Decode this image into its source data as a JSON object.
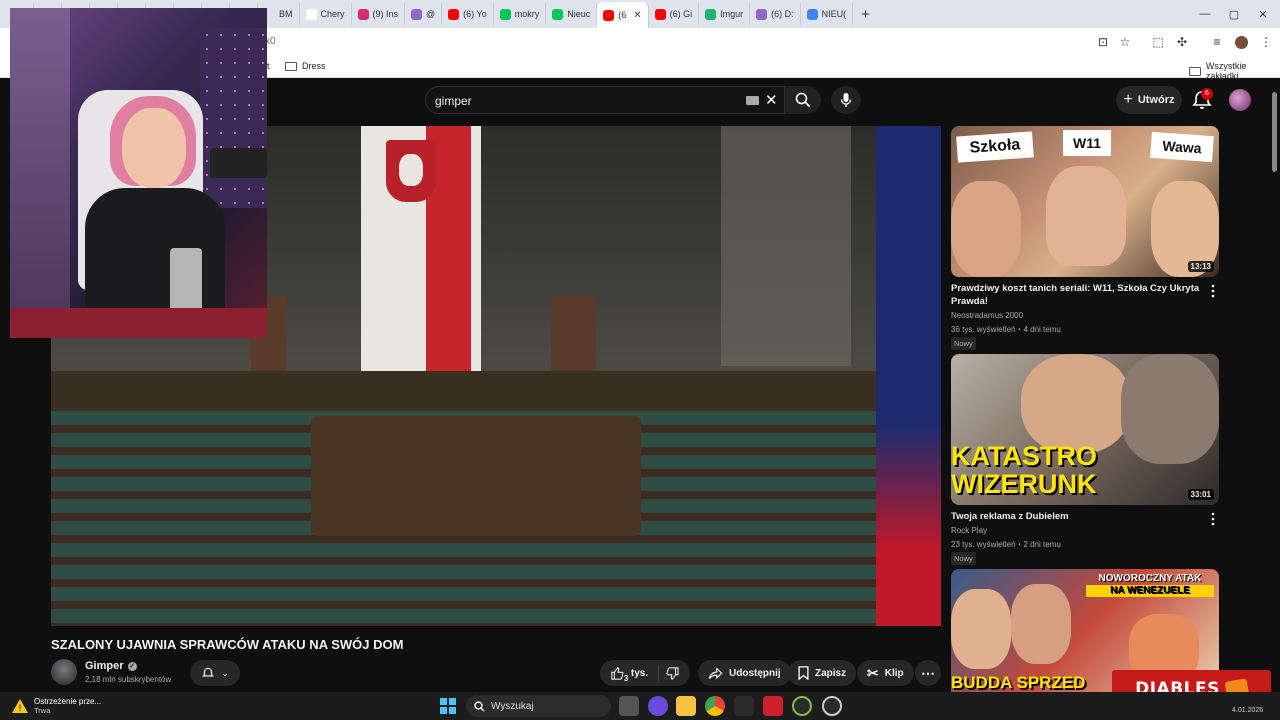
{
  "browser": {
    "tabs": [
      {
        "label": "",
        "color": "#f4b400"
      },
      {
        "label": "",
        "color": "#e25c2d"
      },
      {
        "label": "",
        "color": "#222222"
      },
      {
        "label": "",
        "color": "#1877f2"
      },
      {
        "label": "",
        "color": "#3b3b3b"
      },
      {
        "label": "",
        "color": "#ff0000"
      },
      {
        "label": "",
        "color": "#888888"
      },
      {
        "label": "",
        "color": "#aab4d0"
      },
      {
        "label": "",
        "color": "#777777"
      },
      {
        "label": "BM",
        "color": "#dfe3ee"
      },
      {
        "label": "Chery",
        "color": "#ffffff"
      },
      {
        "label": "(9) Ins",
        "color": "#d62976"
      },
      {
        "label": "@",
        "color": "#8f6ac9"
      },
      {
        "label": "(6) Yo",
        "color": "#ff0000"
      },
      {
        "label": "mokry",
        "color": "#00c853"
      },
      {
        "label": "Nieuc",
        "color": "#00c853"
      },
      {
        "label": "(6",
        "color": "#ff0000"
      },
      {
        "label": "(6) Gi",
        "color": "#ff0000"
      },
      {
        "label": "Imgur",
        "color": "#1bb76e"
      },
      {
        "label": "(6) D:",
        "color": "#8f6ac9"
      },
      {
        "label": "NIEU(",
        "color": "#4285f4"
      }
    ],
    "active_tab_index": 16,
    "url": "x0",
    "bookmarks": {
      "left_partial": "at",
      "dress": "Dress",
      "all_bookmarks": "Wszystkie zakładki"
    }
  },
  "youtube": {
    "search_query": "gimper",
    "create_label": "Utwórz",
    "notif_count": "6",
    "video": {
      "title": "SZALONY UJAWNIA SPRAWCÓW ATAKU NA SWÓJ DOM",
      "channel": "Gimper",
      "subs": "2,18 mln subskrybentów",
      "likes": "tys.",
      "like_small": "3",
      "share_label": "Udostępnij",
      "save_label": "Zapisz",
      "clip_label": "Klip"
    },
    "recommendations": [
      {
        "title": "Prawdziwy koszt tanich seriali: W11, Szkoła Czy Ukryta Prawda!",
        "channel": "Neostradamus 2000",
        "meta": "36 tys. wyświetleń・4 dni temu",
        "badge": "Nowy",
        "duration": "13:13",
        "thumb_text": [
          "Szkoła",
          "W11",
          "Wawa"
        ]
      },
      {
        "title": "Twoja reklama z Dubielem",
        "channel": "Rock Play",
        "meta": "23 tys. wyświetleń・2 dni temu",
        "badge": "Nowy",
        "duration": "33:01",
        "thumb_text": [
          "KATASTRO",
          "WIZERUNK"
        ]
      },
      {
        "title": "",
        "channel": "",
        "meta": "",
        "badge": "",
        "duration": "",
        "thumb_text": [
          "NOWOROCZNY ATAK",
          "NA WENEZUELE",
          "BUDDA SPRZED"
        ]
      }
    ]
  },
  "brand_overlay": "DIABLES",
  "taskbar": {
    "search_placeholder": "Wyszukaj",
    "notification_title": "Ostrzeżenie prze...",
    "notification_sub": "Trwa",
    "clock": "4.01.2026"
  }
}
